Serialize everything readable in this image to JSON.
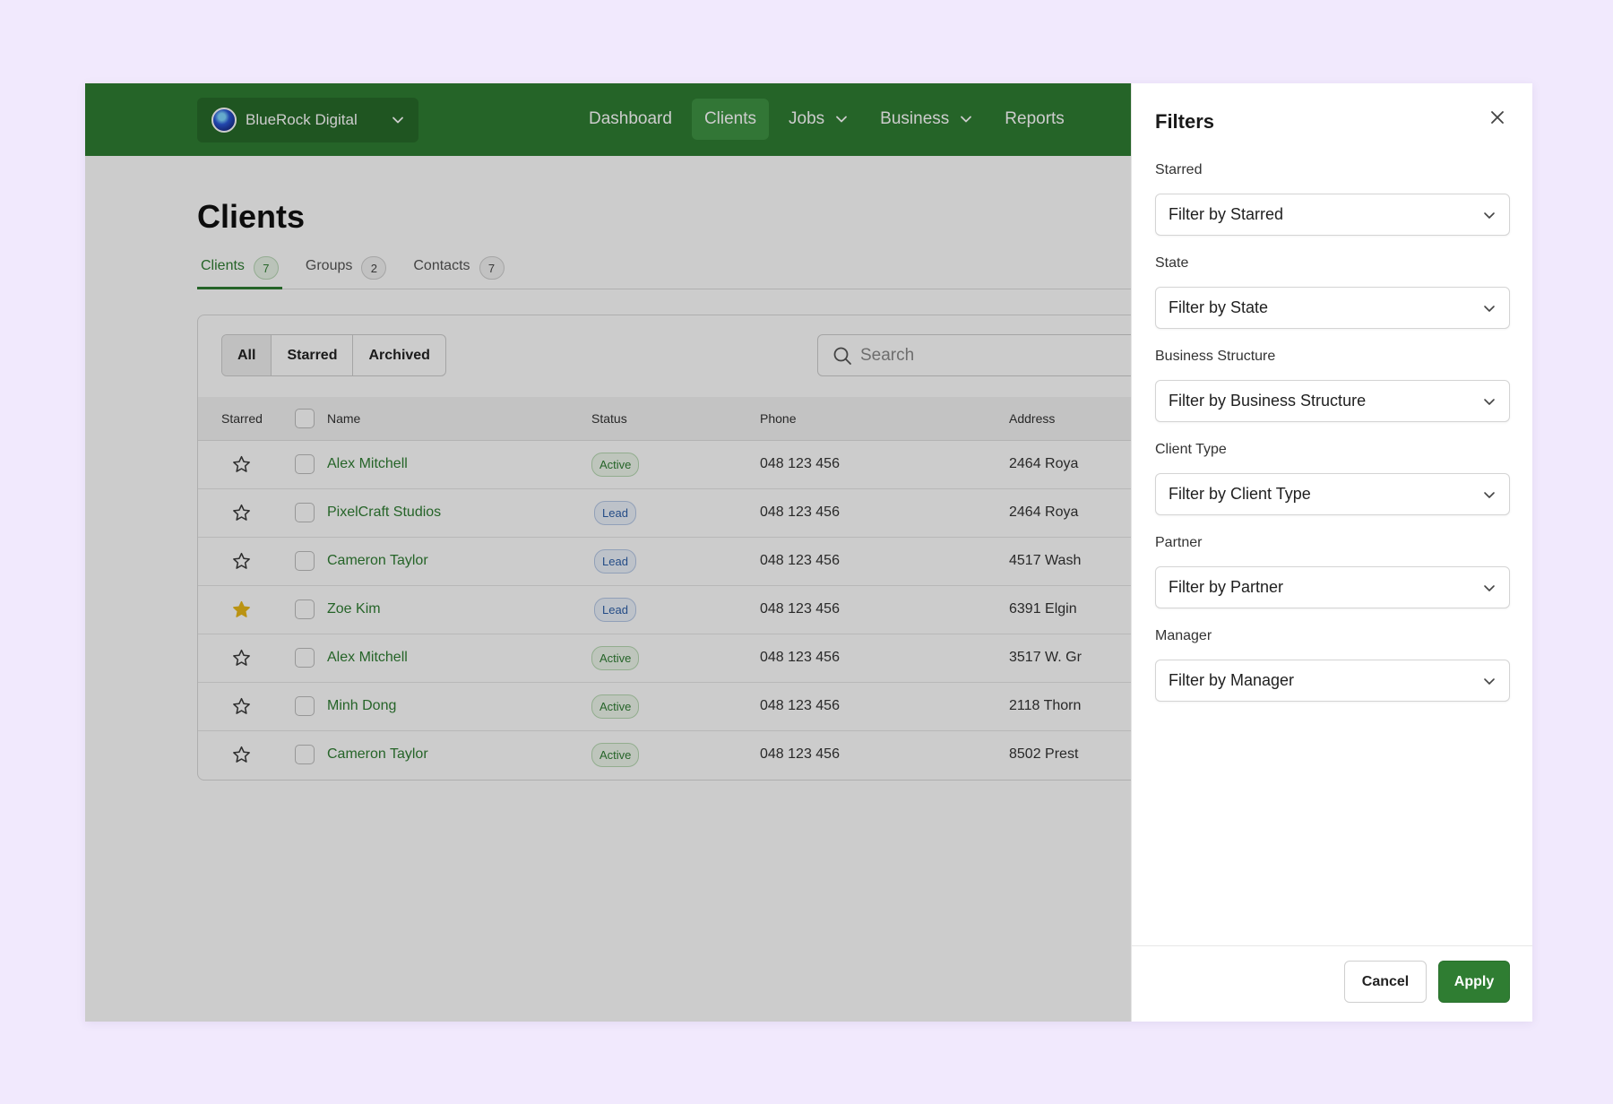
{
  "header": {
    "org_name": "BlueRock Digital",
    "nav": [
      {
        "label": "Dashboard",
        "active": false,
        "dropdown": false
      },
      {
        "label": "Clients",
        "active": true,
        "dropdown": false
      },
      {
        "label": "Jobs",
        "active": false,
        "dropdown": true
      },
      {
        "label": "Business",
        "active": false,
        "dropdown": true
      },
      {
        "label": "Reports",
        "active": false,
        "dropdown": false
      }
    ]
  },
  "page": {
    "title": "Clients",
    "tabs": [
      {
        "label": "Clients",
        "count": "7",
        "active": true
      },
      {
        "label": "Groups",
        "count": "2",
        "active": false
      },
      {
        "label": "Contacts",
        "count": "7",
        "active": false
      }
    ],
    "segments": [
      {
        "label": "All",
        "active": true
      },
      {
        "label": "Starred",
        "active": false
      },
      {
        "label": "Archived",
        "active": false
      }
    ],
    "search_placeholder": "Search"
  },
  "table": {
    "headers": {
      "starred": "Starred",
      "name": "Name",
      "status": "Status",
      "phone": "Phone",
      "address": "Address"
    },
    "rows": [
      {
        "starred": false,
        "name": "Alex Mitchell",
        "status": "Active",
        "phone": "048 123 456",
        "address": "2464 Roya"
      },
      {
        "starred": false,
        "name": "PixelCraft Studios",
        "status": "Lead",
        "phone": "048 123 456",
        "address": "2464 Roya"
      },
      {
        "starred": false,
        "name": "Cameron Taylor",
        "status": "Lead",
        "phone": "048 123 456",
        "address": "4517 Wash"
      },
      {
        "starred": true,
        "name": "Zoe Kim",
        "status": "Lead",
        "phone": "048 123 456",
        "address": "6391 Elgin"
      },
      {
        "starred": false,
        "name": "Alex Mitchell",
        "status": "Active",
        "phone": "048 123 456",
        "address": "3517 W. Gr"
      },
      {
        "starred": false,
        "name": "Minh Dong",
        "status": "Active",
        "phone": "048 123 456",
        "address": "2118 Thorn"
      },
      {
        "starred": false,
        "name": "Cameron Taylor",
        "status": "Active",
        "phone": "048 123 456",
        "address": "8502 Prest"
      }
    ]
  },
  "filters": {
    "title": "Filters",
    "fields": [
      {
        "label": "Starred",
        "placeholder": "Filter by Starred"
      },
      {
        "label": "State",
        "placeholder": "Filter by State"
      },
      {
        "label": "Business Structure",
        "placeholder": "Filter by Business Structure"
      },
      {
        "label": "Client Type",
        "placeholder": "Filter by Client Type"
      },
      {
        "label": "Partner",
        "placeholder": "Filter by Partner"
      },
      {
        "label": "Manager",
        "placeholder": "Filter by Manager"
      }
    ],
    "cancel_label": "Cancel",
    "apply_label": "Apply"
  },
  "colors": {
    "brand_green": "#2f7d32",
    "star_filled": "#e9b818",
    "background": "#f1e9fd"
  }
}
